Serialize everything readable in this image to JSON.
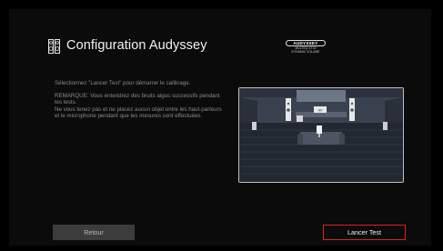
{
  "header": {
    "title": "Configuration Audyssey",
    "icon": "speaker-pair-icon"
  },
  "logo": {
    "brand": "AUDYSSEY",
    "tagline": "MULTEQ XT32\nDYNAMIC VOLUME"
  },
  "instructions": {
    "line1": "Sélectionnez \"Lancer Test\" pour démarrer le calibrage.",
    "note": "REMARQUE: Vous entendrez des bruits aigus successifs pendant les tests.\nNe vous tenez pas et ne placez aucun objet entre les haut-parleurs et le microphone pendant que les mesures sont effectuées."
  },
  "illustration": {
    "icon": "listening-room-illustration",
    "av_receiver_label": "AV"
  },
  "buttons": {
    "back_label": "Retour",
    "start_label": "Lancer Test"
  },
  "colors": {
    "background": "#000000",
    "panel": "#0b0b0b",
    "accent_border": "#e01f1f",
    "back_button": "#3c3c3c"
  }
}
